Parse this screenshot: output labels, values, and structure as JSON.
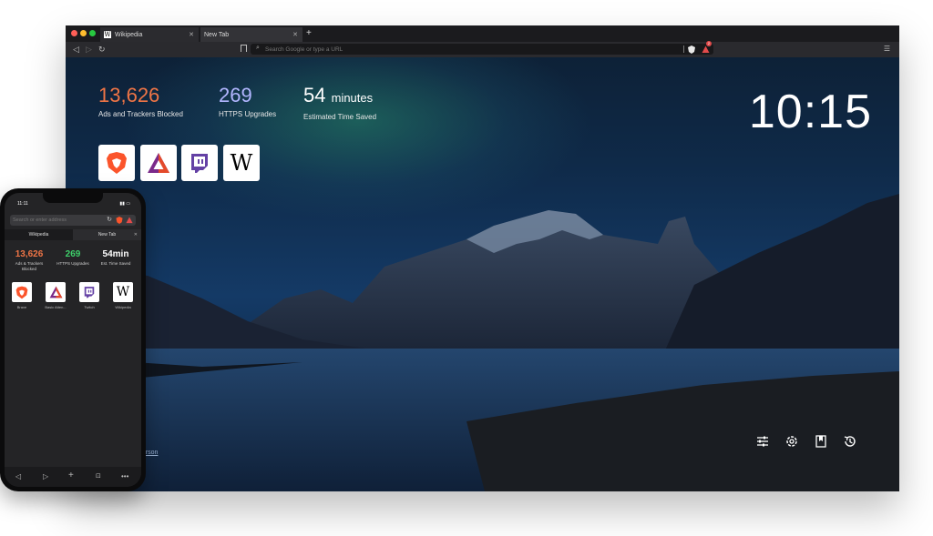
{
  "desktop": {
    "tabs": [
      {
        "label": "Wikipedia"
      },
      {
        "label": "New Tab"
      }
    ],
    "url_placeholder": "Search Google or type a URL",
    "badge_count": "2",
    "stats": [
      {
        "value": "13,626",
        "caption": "Ads and Trackers Blocked",
        "color": "#f07546"
      },
      {
        "value": "269",
        "caption": "HTTPS Upgrades",
        "color": "#b2b6ff"
      },
      {
        "value": "54",
        "unit": "minutes",
        "caption": "Estimated Time Saved",
        "color": "#ffffff"
      }
    ],
    "clock": "10:15",
    "top_sites": [
      {
        "icon": "brave-icon"
      },
      {
        "icon": "bat-icon"
      },
      {
        "icon": "twitch-icon"
      },
      {
        "icon": "wikipedia-icon"
      }
    ],
    "photo_credit": "derson",
    "bottom_icons": [
      "customize-icon",
      "settings-icon",
      "bookmarks-icon",
      "history-icon"
    ]
  },
  "phone": {
    "time": "11:11",
    "url_placeholder": "Search or enter address",
    "tabs": [
      {
        "label": "Wikipedia"
      },
      {
        "label": "New Tab"
      }
    ],
    "stats": [
      {
        "value": "13,626",
        "caption": "Ads & Trackers Blocked",
        "color": "#f07546"
      },
      {
        "value": "269",
        "caption": "HTTPS Upgrades",
        "color": "#3ecf6a"
      },
      {
        "value": "54min",
        "caption": "Est. Time Saved",
        "color": "#ffffff"
      }
    ],
    "top_sites": [
      {
        "label": "Brave"
      },
      {
        "label": "Basic Atten..."
      },
      {
        "label": "Twitch"
      },
      {
        "label": "Wikipedia"
      }
    ]
  },
  "colors": {
    "brave_orange": "#fb542b",
    "twitch_purple": "#6441a5"
  }
}
